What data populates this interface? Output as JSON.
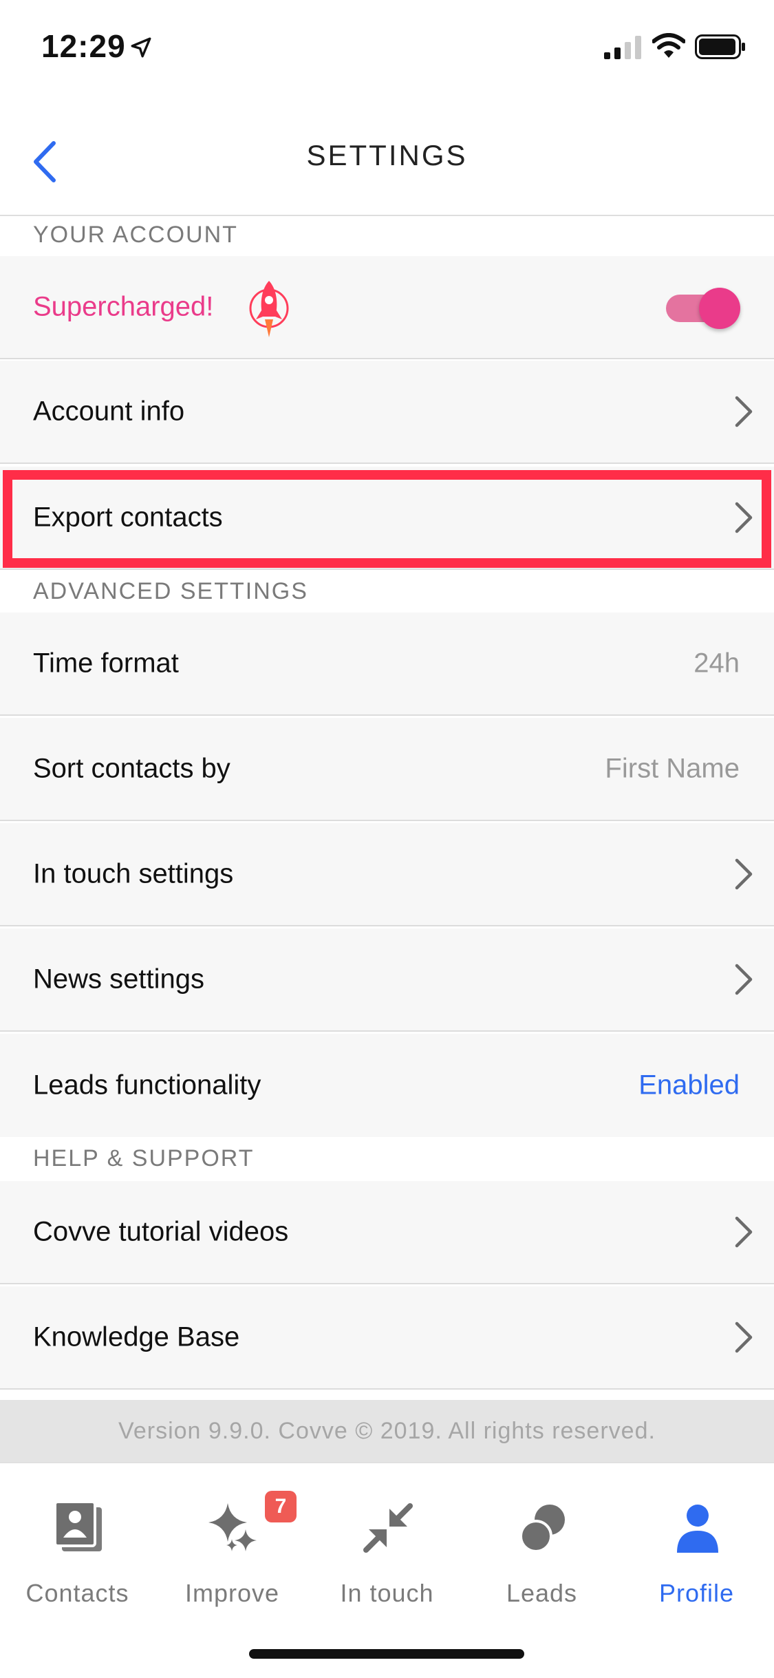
{
  "status": {
    "time": "12:29"
  },
  "nav": {
    "title": "SETTINGS"
  },
  "sections": {
    "account": "YOUR ACCOUNT",
    "advanced": "ADVANCED SETTINGS",
    "help": "HELP & SUPPORT"
  },
  "account": {
    "supercharged_label": "Supercharged!",
    "supercharged_on": true,
    "account_info": "Account info",
    "export_contacts": "Export contacts"
  },
  "advanced": {
    "time_format_label": "Time format",
    "time_format_value": "24h",
    "sort_label": "Sort contacts by",
    "sort_value": "First Name",
    "in_touch_label": "In touch settings",
    "news_label": "News settings",
    "leads_label": "Leads functionality",
    "leads_value": "Enabled"
  },
  "help": {
    "tutorials": "Covve tutorial videos",
    "knowledge": "Knowledge Base"
  },
  "footer": {
    "version": "Version 9.9.0. Covve © 2019. All rights reserved."
  },
  "tabs": [
    {
      "label": "Contacts",
      "icon": "contacts-icon"
    },
    {
      "label": "Improve",
      "icon": "sparkle-icon",
      "badge": "7"
    },
    {
      "label": "In touch",
      "icon": "arrows-inward-icon"
    },
    {
      "label": "Leads",
      "icon": "leads-icon"
    },
    {
      "label": "Profile",
      "icon": "person-icon",
      "active": true
    }
  ],
  "colors": {
    "accent": "#2f6bf0",
    "supercharged": "#ea3b8a",
    "highlight": "#ff2d48",
    "badge": "#ef5b55"
  }
}
